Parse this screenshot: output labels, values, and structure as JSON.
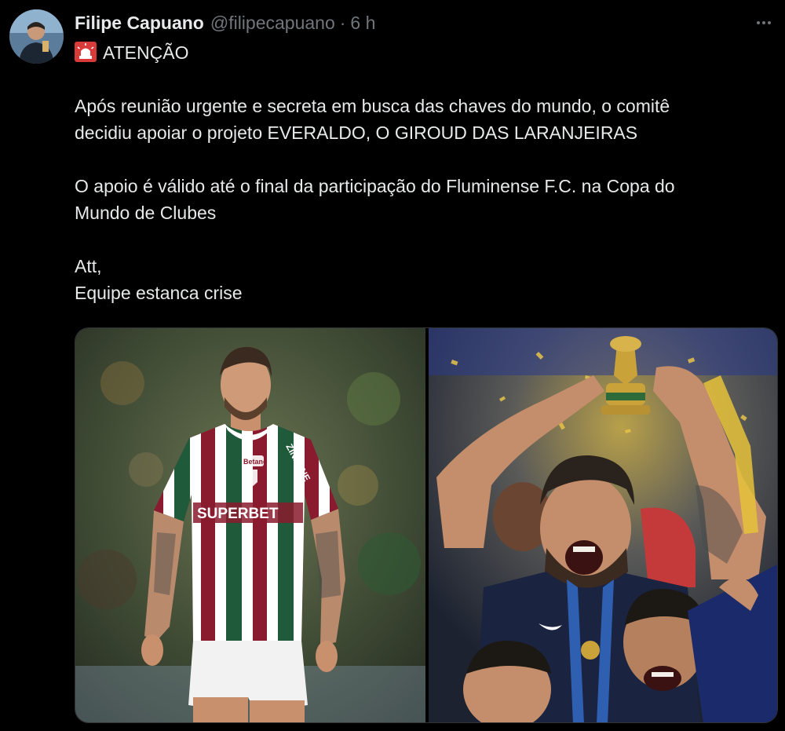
{
  "author": {
    "display_name": "Filipe Capuano",
    "handle": "@filipecapuano",
    "separator": "·",
    "time": "6 h"
  },
  "post": {
    "headline_icon": "rotating-light-emoji",
    "headline": "ATENÇÃO",
    "para1_line1": "Após reunião urgente e secreta em busca das chaves do mundo, o comitê",
    "para1_line2": "decidiu apoiar o projeto EVERALDO, O GIROUD DAS LARANJEIRAS",
    "para2_line1": "O apoio é válido até o final da participação do Fluminense F.C. na Copa do",
    "para2_line2": "Mundo de Clubes",
    "sign_line1": "Att,",
    "sign_line2": "Equipe estanca crise"
  },
  "media": {
    "left_jersey_sponsor": "SUPERBET",
    "left_jersey_sleeve": "ZINZANE",
    "left_jersey_badge": "Betano"
  },
  "colors": {
    "background": "#000000",
    "text": "#e7e9ea",
    "muted": "#71767b",
    "border": "#2f3336",
    "fluminense_maroon": "#8a1b2e",
    "fluminense_green": "#1f5b3a",
    "france_navy": "#1a2340"
  }
}
